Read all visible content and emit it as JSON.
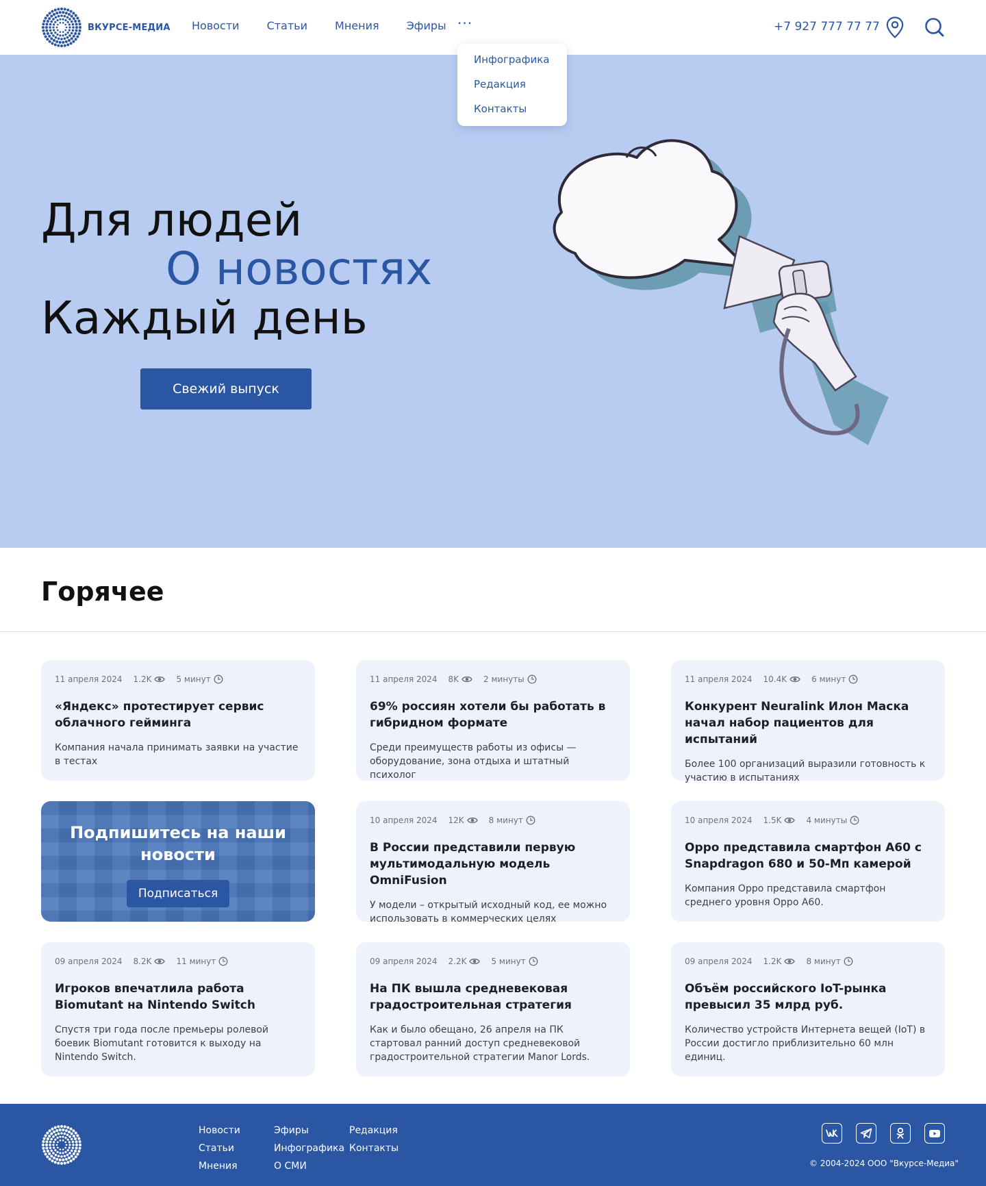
{
  "brand": {
    "name": "ВКУРСЕ-МЕДИА",
    "accent": "#2a56a3",
    "hero_bg": "#b8cbf1"
  },
  "nav": {
    "items": [
      {
        "label": "Новости"
      },
      {
        "label": "Статьи"
      },
      {
        "label": "Мнения"
      },
      {
        "label": "Эфиры"
      }
    ],
    "more_label": "···",
    "dropdown": [
      {
        "label": "Инфографика"
      },
      {
        "label": "Редакция"
      },
      {
        "label": "Контакты"
      }
    ]
  },
  "header": {
    "phone": "+7 927 777 77 77",
    "location_icon": "map-pin-icon",
    "search_icon": "search-icon"
  },
  "hero": {
    "line1": "Для людей",
    "line2": "О новостях",
    "line3": "Каждый день",
    "button": "Свежий выпуск",
    "illustration": "megaphone-speech-bubble-illustration"
  },
  "hot": {
    "title": "Горячее",
    "cards": [
      {
        "date": "11 апреля 2024",
        "views": "1.2K",
        "read_time": "5 минут",
        "title": "«Яндекс» протестирует сервис облачного гейминга",
        "desc": "Компания начала принимать заявки на участие в тестах"
      },
      {
        "date": "11 апреля 2024",
        "views": "8K",
        "read_time": "2 минуты",
        "title": "69% россиян хотели бы работать в гибридном формате",
        "desc": "Среди преимуществ работы из офисы — оборудование, зона отдыха и штатный психолог"
      },
      {
        "date": "11 апреля 2024",
        "views": "10.4K",
        "read_time": "6 минут",
        "title": "Конкурент Neuralink Илон Маска начал набор пациентов для испытаний",
        "desc": "Более 100 организаций выразили готовность к участию в испытаниях"
      },
      {
        "date": "10 апреля 2024",
        "views": "12K",
        "read_time": "8 минут",
        "title": "В России представили первую мультимодальную модель OmniFusion",
        "desc": "У модели – открытый исходный код, ее можно использовать в коммерческих целях"
      },
      {
        "date": "10 апреля 2024",
        "views": "1.5K",
        "read_time": "4 минуты",
        "title": "Oppo представила смартфон A60 с Snapdragon 680 и 50-Мп камерой",
        "desc": "Компания Oppo представила смартфон среднего уровня Oppo A60."
      },
      {
        "date": "09 апреля 2024",
        "views": "8.2K",
        "read_time": "11 минут",
        "title": "Игроков впечатлила работа Biomutant на Nintendo Switch",
        "desc": "Спустя три года после премьеры ролевой боевик Biomutant готовится к выходу на Nintendo Switch."
      },
      {
        "date": "09 апреля 2024",
        "views": "2.2K",
        "read_time": "5 минут",
        "title": "На ПК вышла средневековая градостроительная стратегия",
        "desc": "Как и было обещано, 26 апреля на ПК стартовал ранний доступ средневековой градостроительной стратегии Manor Lords."
      },
      {
        "date": "09 апреля 2024",
        "views": "1.2K",
        "read_time": "8 минут",
        "title": "Объём российского IoT-рынка превысил 35 млрд руб.",
        "desc": "Количество устройств Интернета вещей (IoT) в России достигло приблизительно 60 млн единиц."
      }
    ],
    "promo": {
      "title": "Подпишитесь на наши новости",
      "button": "Подписаться"
    }
  },
  "footer": {
    "col1": [
      "Новости",
      "Статьи",
      "Мнения"
    ],
    "col2": [
      "Эфиры",
      "Инфографика",
      "О СМИ"
    ],
    "col3": [
      "Редакция",
      "Контакты"
    ],
    "social": [
      "vk-icon",
      "telegram-icon",
      "odnoklassniki-icon",
      "youtube-icon"
    ],
    "copyright": "© 2004-2024 ООО \"Вкурсе-Медиа\""
  }
}
